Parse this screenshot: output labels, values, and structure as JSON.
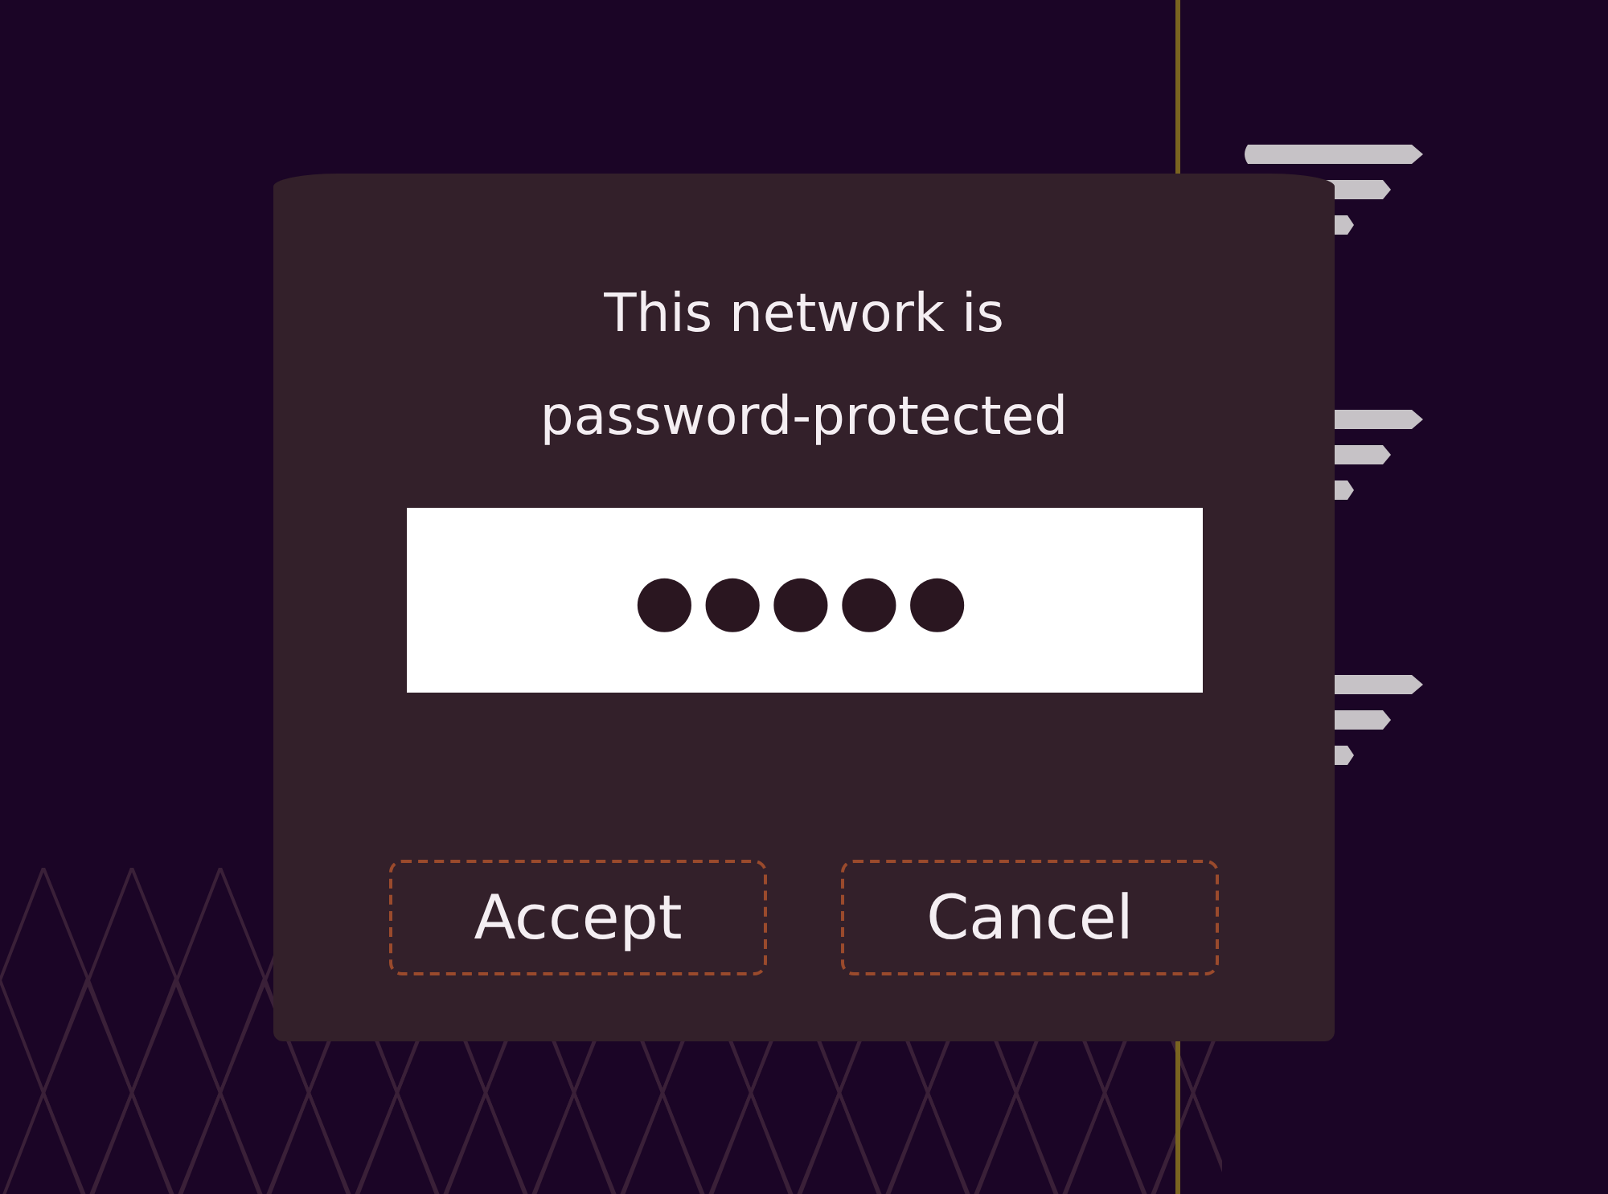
{
  "dialog": {
    "title": "This network is password-protected",
    "password_field": {
      "value": "●●●●●"
    },
    "buttons": [
      {
        "label": "Accept"
      },
      {
        "label": "Cancel"
      }
    ]
  }
}
